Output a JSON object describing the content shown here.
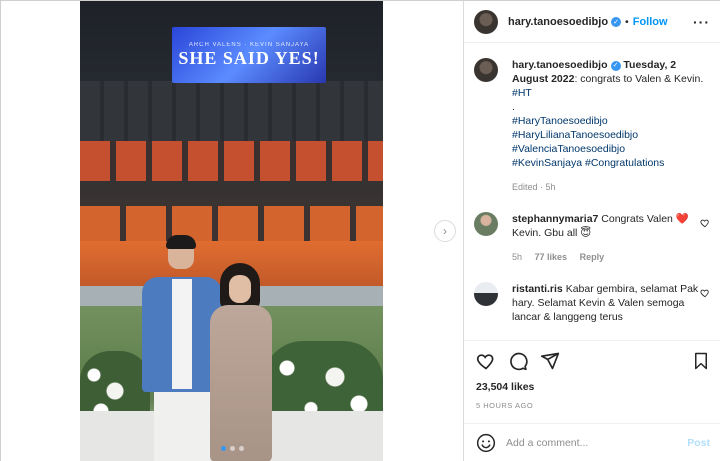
{
  "post": {
    "photo": {
      "screen_subtext": "ARCH VALENS · KEVIN SANJAYA",
      "screen_text": "SHE SAID YES!",
      "carousel_dots": 3,
      "active_dot": 0
    },
    "header": {
      "username": "hary.tanoesoedibjo",
      "separator": "•",
      "follow_label": "Follow",
      "more_label": "···"
    },
    "caption": {
      "username": "hary.tanoesoedibjo",
      "date_text": "Tuesday, 2 August 2022",
      "text": ": congrats to Valen & Kevin. ",
      "tag_ht": "#HT",
      "dot_line": ".",
      "hashtags": [
        "#HaryTanoesoedibjo",
        "#HaryLilianaTanoesoedibjo",
        "#ValenciaTanoesoedibjo",
        "#KevinSanjaya",
        "#Congratulations"
      ],
      "meta": "Edited · 5h"
    },
    "comments": [
      {
        "username": "stephannymaria7",
        "text_before": " Congrats Valen",
        "heart_emoji": "❤️",
        "text_after": " Kevin. Gbu all ",
        "end_emoji": "😇",
        "time": "5h",
        "likes": "77 likes",
        "reply_label": "Reply"
      },
      {
        "username": "ristanti.ris",
        "text": " Kabar gembira, selamat Pak hary. Selamat Kevin & Valen semoga lancar & langgeng terus"
      }
    ],
    "likes_count": "23,504 likes",
    "time_ago": "5 HOURS AGO",
    "comment_input": {
      "placeholder": "Add a comment...",
      "post_label": "Post"
    },
    "colors": {
      "accent": "#0095f6",
      "verified": "#3897f0",
      "hashtag": "#00376b",
      "heart_red": "#ed4956"
    }
  }
}
